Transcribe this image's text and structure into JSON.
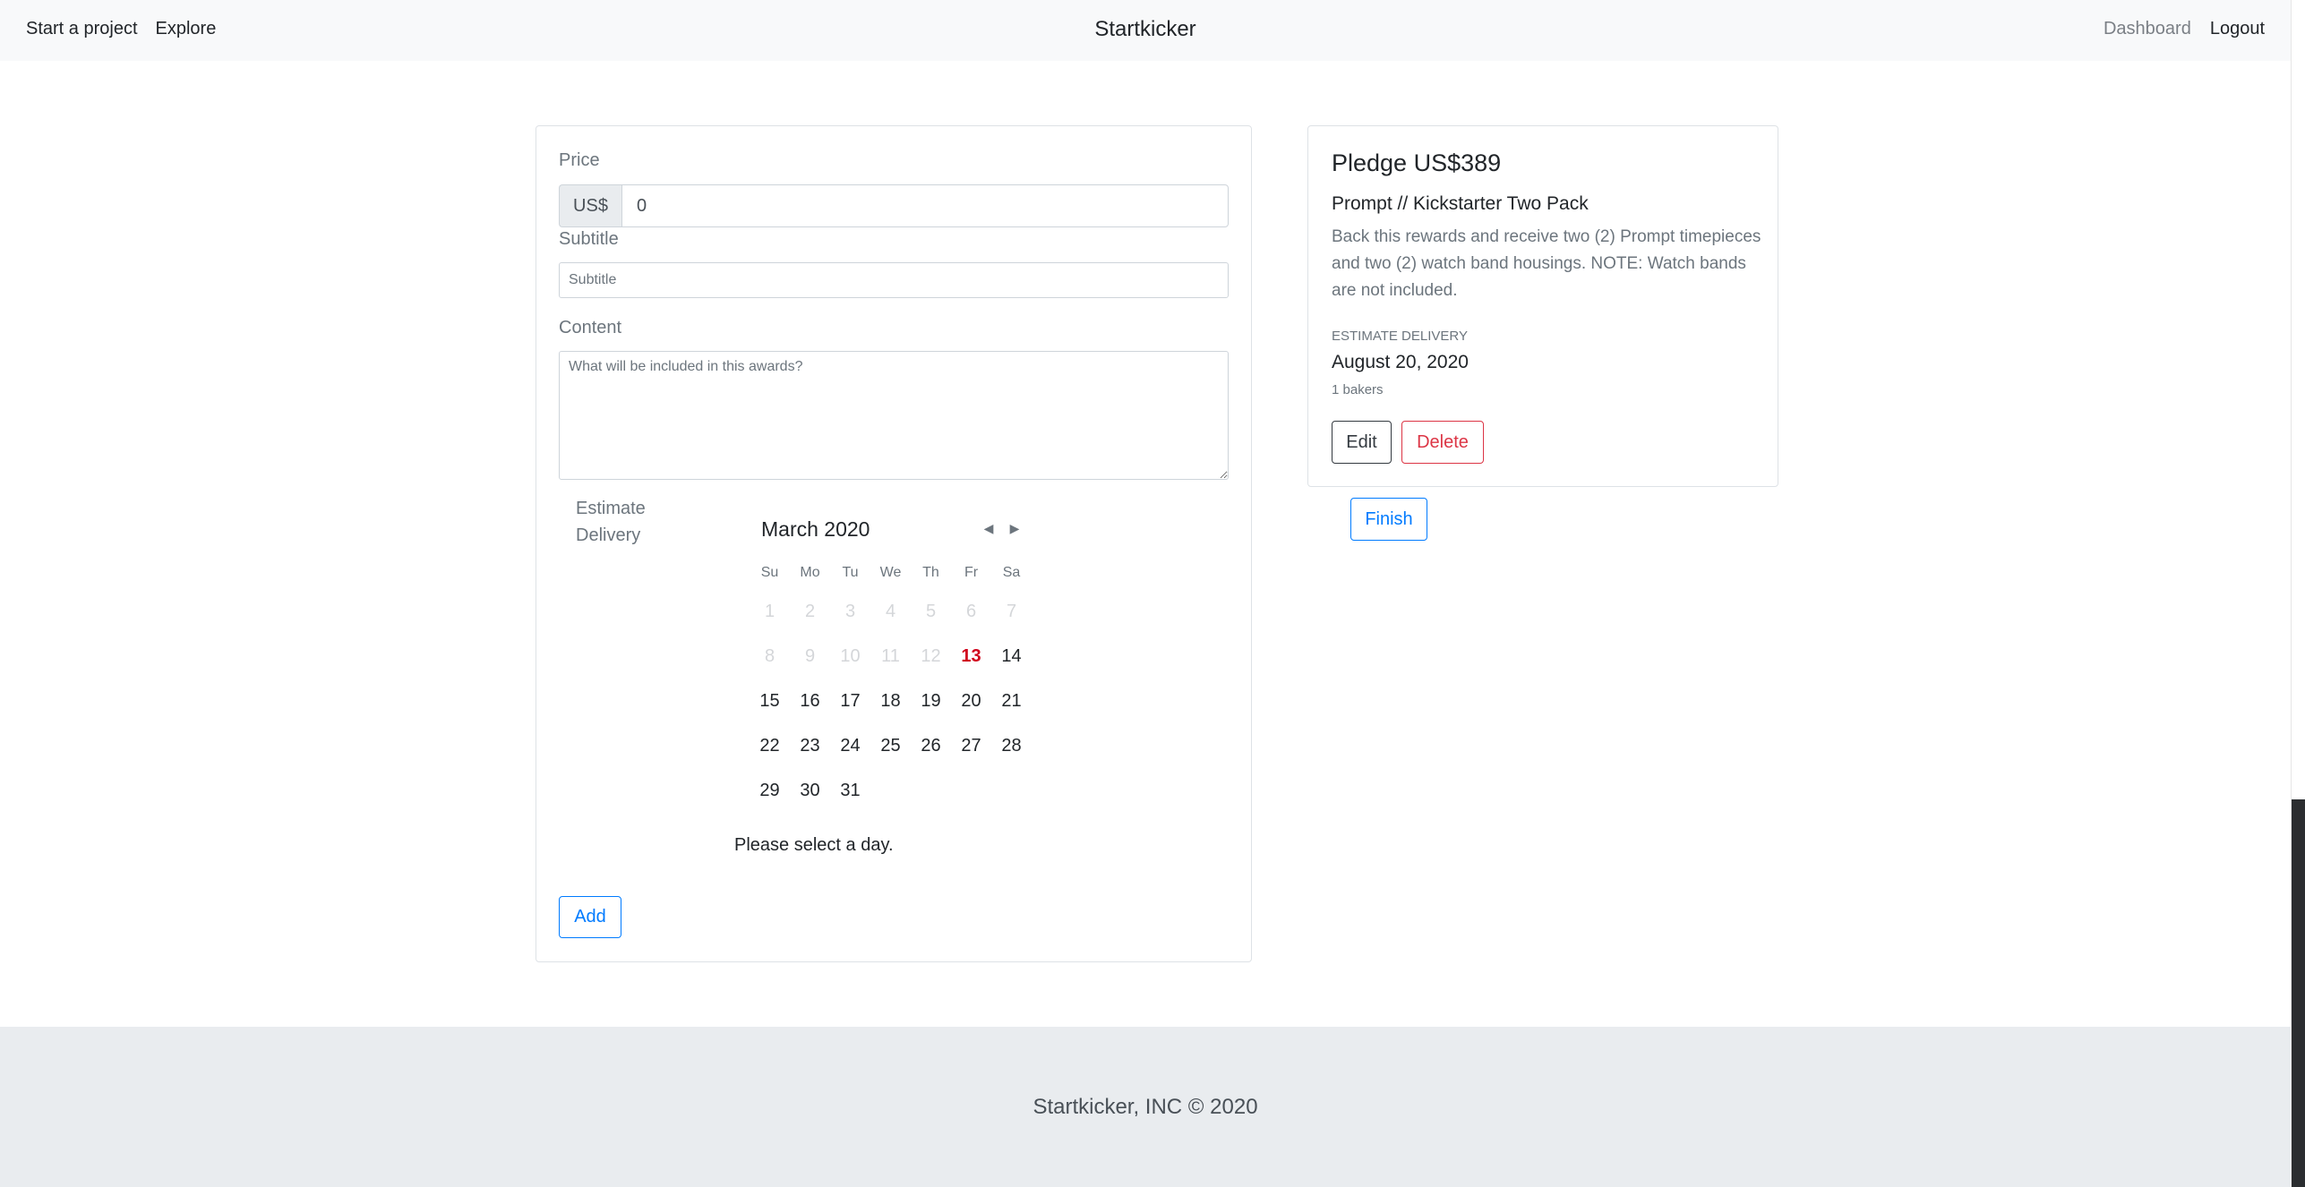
{
  "nav": {
    "start_project": "Start a project",
    "explore": "Explore",
    "brand": "Startkicker",
    "dashboard": "Dashboard",
    "logout": "Logout"
  },
  "form": {
    "price_label": "Price",
    "currency": "US$",
    "price_value": "0",
    "subtitle_label": "Subtitle",
    "subtitle_placeholder": "Subtitle",
    "content_label": "Content",
    "content_placeholder": "What will be included in this awards?",
    "estimate_label": "Estimate Delivery",
    "add_label": "Add"
  },
  "calendar": {
    "month_year": "March 2020",
    "weekdays": [
      "Su",
      "Mo",
      "Tu",
      "We",
      "Th",
      "Fr",
      "Sa"
    ],
    "weeks": [
      [
        "1",
        "2",
        "3",
        "4",
        "5",
        "6",
        "7"
      ],
      [
        "8",
        "9",
        "10",
        "11",
        "12",
        "13",
        "14"
      ],
      [
        "15",
        "16",
        "17",
        "18",
        "19",
        "20",
        "21"
      ],
      [
        "22",
        "23",
        "24",
        "25",
        "26",
        "27",
        "28"
      ],
      [
        "29",
        "30",
        "31",
        "",
        "",
        "",
        ""
      ]
    ],
    "disabled_through": 12,
    "today": "13",
    "note": "Please select a day."
  },
  "reward": {
    "pledge": "Pledge US$389",
    "title": "Prompt // Kickstarter Two Pack",
    "description": "Back this rewards and receive two (2) Prompt timepieces and two (2) watch band housings. NOTE: Watch bands are not included.",
    "estimate_label": "ESTIMATE DELIVERY",
    "estimate_date": "August 20, 2020",
    "bakers": "1 bakers",
    "edit_label": "Edit",
    "delete_label": "Delete"
  },
  "finish_label": "Finish",
  "footer": "Startkicker, INC © 2020",
  "colors": {
    "primary": "#007bff",
    "danger": "#dc3545",
    "today": "#d0021b",
    "navbar_bg": "#f8f9fa",
    "footer_bg": "#e9ecef"
  }
}
